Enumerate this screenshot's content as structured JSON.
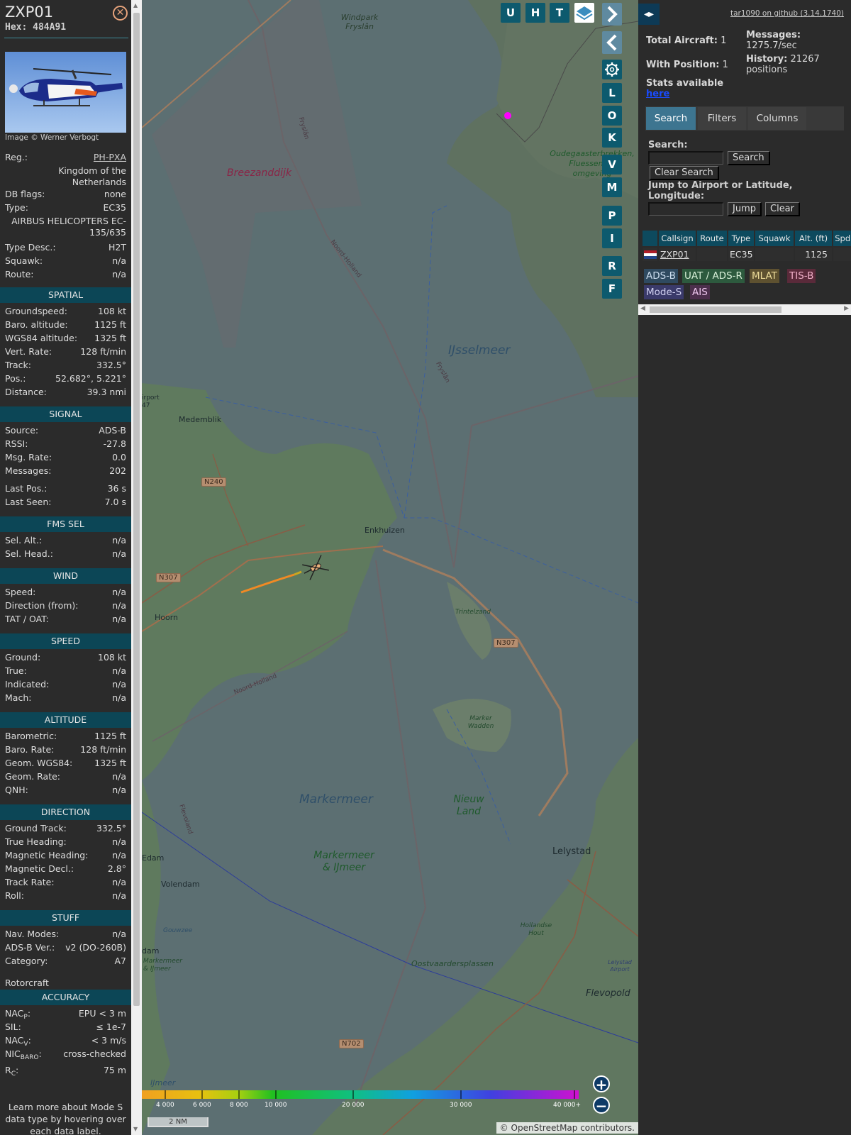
{
  "aircraft": {
    "callsign": "ZXP01",
    "hex": "Hex: 484A91",
    "photo_credit": "Image © Werner Verbogt",
    "details": [
      {
        "k": "Reg.:",
        "v": "PH-PXA"
      },
      {
        "k": "DB flags:",
        "v": "none"
      },
      {
        "k": "Type:",
        "v": "EC35"
      },
      {
        "k": "Type Desc.:",
        "v": "H2T"
      },
      {
        "k": "Squawk:",
        "v": "n/a"
      },
      {
        "k": "Route:",
        "v": "n/a"
      }
    ],
    "country": "Kingdom of the Netherlands",
    "type_full": "AIRBUS HELICOPTERS EC-135/635"
  },
  "sections": {
    "spatial": {
      "title": "SPATIAL",
      "rows": [
        {
          "k": "Groundspeed:",
          "v": "108 kt"
        },
        {
          "k": "Baro. altitude:",
          "v": "1125 ft"
        },
        {
          "k": "WGS84 altitude:",
          "v": "1325 ft"
        },
        {
          "k": "Vert. Rate:",
          "v": "128 ft/min"
        },
        {
          "k": "Track:",
          "v": "332.5°"
        },
        {
          "k": "Pos.:",
          "v": "52.682°, 5.221°"
        },
        {
          "k": "Distance:",
          "v": "39.3 nmi"
        }
      ]
    },
    "signal": {
      "title": "SIGNAL",
      "rows": [
        {
          "k": "Source:",
          "v": "ADS-B"
        },
        {
          "k": "RSSI:",
          "v": "-27.8"
        },
        {
          "k": "Msg. Rate:",
          "v": "0.0"
        },
        {
          "k": "Messages:",
          "v": "202"
        },
        {
          "k": "Last Pos.:",
          "v": "36 s"
        },
        {
          "k": "Last Seen:",
          "v": "7.0 s"
        }
      ]
    },
    "fms": {
      "title": "FMS SEL",
      "rows": [
        {
          "k": "Sel. Alt.:",
          "v": "n/a"
        },
        {
          "k": "Sel. Head.:",
          "v": "n/a"
        }
      ]
    },
    "wind": {
      "title": "WIND",
      "rows": [
        {
          "k": "Speed:",
          "v": "n/a"
        },
        {
          "k": "Direction (from):",
          "v": "n/a"
        },
        {
          "k": "TAT / OAT:",
          "v": "n/a"
        }
      ]
    },
    "speed": {
      "title": "SPEED",
      "rows": [
        {
          "k": "Ground:",
          "v": "108 kt"
        },
        {
          "k": "True:",
          "v": "n/a"
        },
        {
          "k": "Indicated:",
          "v": "n/a"
        },
        {
          "k": "Mach:",
          "v": "n/a"
        }
      ]
    },
    "altitude": {
      "title": "ALTITUDE",
      "rows": [
        {
          "k": "Barometric:",
          "v": "1125 ft"
        },
        {
          "k": "Baro. Rate:",
          "v": "128 ft/min"
        },
        {
          "k": "Geom. WGS84:",
          "v": "1325 ft"
        },
        {
          "k": "Geom. Rate:",
          "v": "n/a"
        },
        {
          "k": "QNH:",
          "v": "n/a"
        }
      ]
    },
    "direction": {
      "title": "DIRECTION",
      "rows": [
        {
          "k": "Ground Track:",
          "v": "332.5°"
        },
        {
          "k": "True Heading:",
          "v": "n/a"
        },
        {
          "k": "Magnetic Heading:",
          "v": "n/a"
        },
        {
          "k": "Magnetic Decl.:",
          "v": "2.8°"
        },
        {
          "k": "Track Rate:",
          "v": "n/a"
        },
        {
          "k": "Roll:",
          "v": "n/a"
        }
      ]
    },
    "stuff": {
      "title": "STUFF",
      "rows": [
        {
          "k": "Nav. Modes:",
          "v": "n/a"
        },
        {
          "k": "ADS-B Ver.:",
          "v": "v2 (DO-260B)"
        },
        {
          "k": "Category:",
          "v": "A7"
        }
      ],
      "category_desc": "Rotorcraft"
    },
    "accuracy": {
      "title": "ACCURACY",
      "rows": [
        {
          "k": "NAC",
          "sub": "P",
          "v": "EPU < 3 m"
        },
        {
          "k": "SIL:",
          "sub": "",
          "v": "≤ 1e-7"
        },
        {
          "k": "NAC",
          "sub": "V",
          "v": "< 3 m/s"
        },
        {
          "k": "NIC",
          "sub": "BARO",
          "v": "cross-checked"
        },
        {
          "k": "R",
          "sub": "C",
          "v": "75 m"
        }
      ]
    },
    "footnote": "Learn more about Mode S data type by hovering over each data label."
  },
  "map": {
    "buttons": [
      "U",
      "H",
      "T",
      "L",
      "O",
      "K",
      "V",
      "M",
      "P",
      "I",
      "R",
      "F"
    ],
    "labels": {
      "windpark": "Windpark Fryslân",
      "breezanddijk": "Breezanddijk",
      "ijsselmeer": "IJsselmeer",
      "oudega": "Oudegaasterbrekken, Fluessen en omgeving",
      "medemblik": "Medemblik",
      "enkhuizen": "Enkhuizen",
      "hoorn": "Hoorn",
      "trintelzand": "Trintelzand",
      "markermeer": "Markermeer",
      "nieuwland": "Nieuw Land",
      "markermeer_ij": "Markermeer & IJmeer",
      "markerwadden": "Marker Wadden",
      "lelystad": "Lelystad",
      "volendam": "Volendam",
      "edam": "Edam",
      "dam": "dam",
      "oostvaardersplassen": "Oostvaardersplassen",
      "hollandse_hout": "Hollandse Hout",
      "flevopolder": "Flevopold",
      "gouwzee": "Gouwzee",
      "markermeer_ij2": "Markermeer & IJmeer",
      "ijmeer": "IJmeer",
      "noordholland1": "Noord-Holland",
      "noordholland2": "Noord-Holland",
      "fryslan1": "Fryslân",
      "fryslan2": "Fryslân",
      "flevoland": "Flevoland",
      "airport": "irport",
      "airport2": "47",
      "lelystad_airport": "Lelystad Airport",
      "dam2": "dam"
    },
    "roads": [
      "N240",
      "N307",
      "N307",
      "N702"
    ],
    "colorbar_ticks": [
      "4 000",
      "6 000",
      "8 000",
      "10 000",
      "20 000",
      "30 000",
      "40 000+"
    ],
    "scale": "2 NM",
    "attribution": "© OpenStreetMap contributors."
  },
  "sidebar": {
    "github": "tar1090 on github (3.14.1740)",
    "total_aircraft_label": "Total Aircraft:",
    "total_aircraft": "1",
    "with_position_label": "With Position:",
    "with_position": "1",
    "messages_label": "Messages:",
    "messages": "1275.7/sec",
    "history_label": "History:",
    "history": "21267 positions",
    "stats_text": "Stats available",
    "stats_link": "here",
    "tabs": [
      "Search",
      "Filters",
      "Columns"
    ],
    "search_label": "Search:",
    "search_button": "Search",
    "clear_search": "Clear Search",
    "jump_label": "Jump to Airport or Latitude, Longitude:",
    "jump_button": "Jump",
    "clear_button": "Clear",
    "columns": [
      "Callsign",
      "Route",
      "Type",
      "Squawk",
      "Alt. (ft)",
      "Spd."
    ],
    "row": {
      "callsign": "ZXP01",
      "route": "",
      "type": "EC35",
      "squawk": "",
      "alt": "1125"
    },
    "legend": [
      {
        "label": "ADS-B",
        "bg": "#2f4a60",
        "color": "#cde"
      },
      {
        "label": "UAT / ADS-R",
        "bg": "#2d5a3e",
        "color": "#d7eed7"
      },
      {
        "label": "MLAT",
        "bg": "#5e5130",
        "color": "#eedd9a"
      },
      {
        "label": "TIS-B",
        "bg": "#5a2a3a",
        "color": "#f0b0c8"
      },
      {
        "label": "Mode-S",
        "bg": "#3a3a6a",
        "color": "#d0d0f0"
      },
      {
        "label": "AIS",
        "bg": "#4c2f4c",
        "color": "#f0c8f0"
      }
    ]
  }
}
